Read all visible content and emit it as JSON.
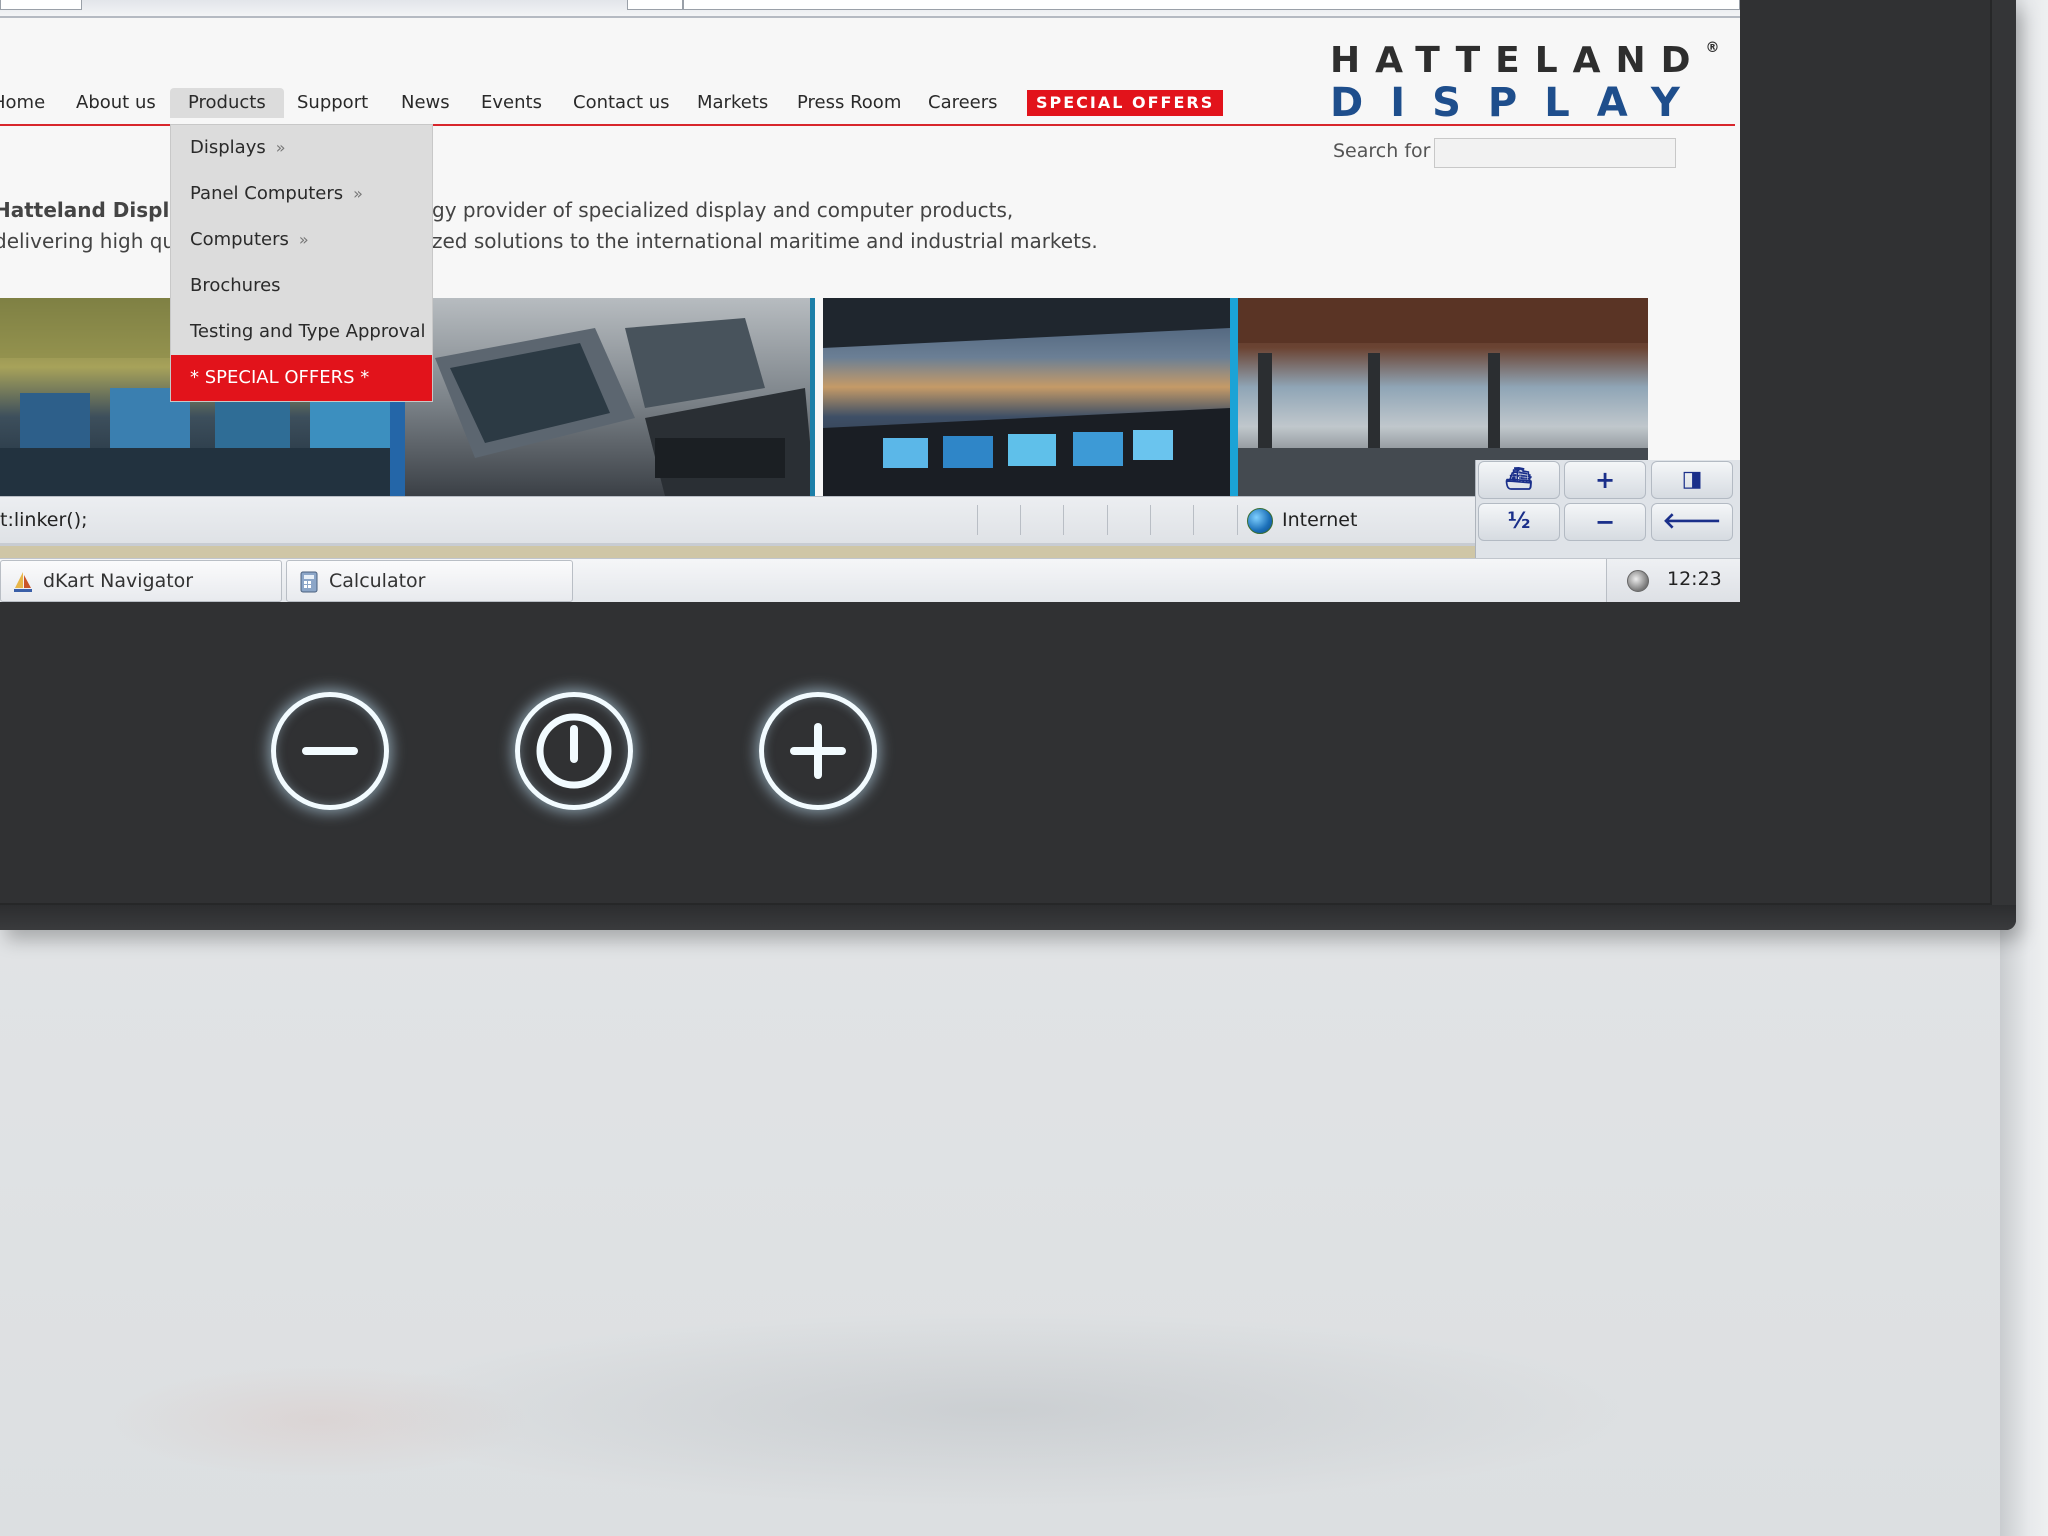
{
  "nav": {
    "items": [
      {
        "label": "Home"
      },
      {
        "label": "About us"
      },
      {
        "label": "Products"
      },
      {
        "label": "Support"
      },
      {
        "label": "News"
      },
      {
        "label": "Events"
      },
      {
        "label": "Contact us"
      },
      {
        "label": "Markets"
      },
      {
        "label": "Press Room"
      },
      {
        "label": "Careers"
      }
    ],
    "special": "SPECIAL OFFERS",
    "active": "Products"
  },
  "logo": {
    "line1": "HATTELAND",
    "registered": "®",
    "line2": "DISPLAY"
  },
  "search": {
    "label": "Search for",
    "value": ""
  },
  "intro": {
    "line1_strong": "Hatteland Displ",
    "line1_rest": "gy provider of specialized display and computer products,",
    "line2_start": "delivering high qu",
    "line2_rest": "zed solutions to the international maritime and industrial markets."
  },
  "dropdown": {
    "items": [
      {
        "label": "Displays",
        "submenu": "»"
      },
      {
        "label": "Panel Computers",
        "submenu": "»"
      },
      {
        "label": "Computers",
        "submenu": "»"
      },
      {
        "label": "Brochures"
      },
      {
        "label": "Testing and Type Approval"
      },
      {
        "label": "* SPECIAL OFFERS *"
      }
    ]
  },
  "statusbar": {
    "text": "t:linker();",
    "zone": "Internet"
  },
  "keypad": {
    "keys": [
      "⛴",
      "+",
      "◨",
      "½",
      "−",
      "🡐"
    ]
  },
  "taskbar": {
    "tasks": [
      {
        "label": "dKart Navigator"
      },
      {
        "label": "Calculator"
      }
    ],
    "clock": "12:23"
  },
  "colors": {
    "accent_red": "#e2131b",
    "logo_blue": "#1e4e8c",
    "bezel": "#343537",
    "glow": "#f2fbff"
  },
  "icons": {
    "hw_buttons": [
      "minus-icon",
      "power-icon",
      "plus-icon"
    ]
  }
}
